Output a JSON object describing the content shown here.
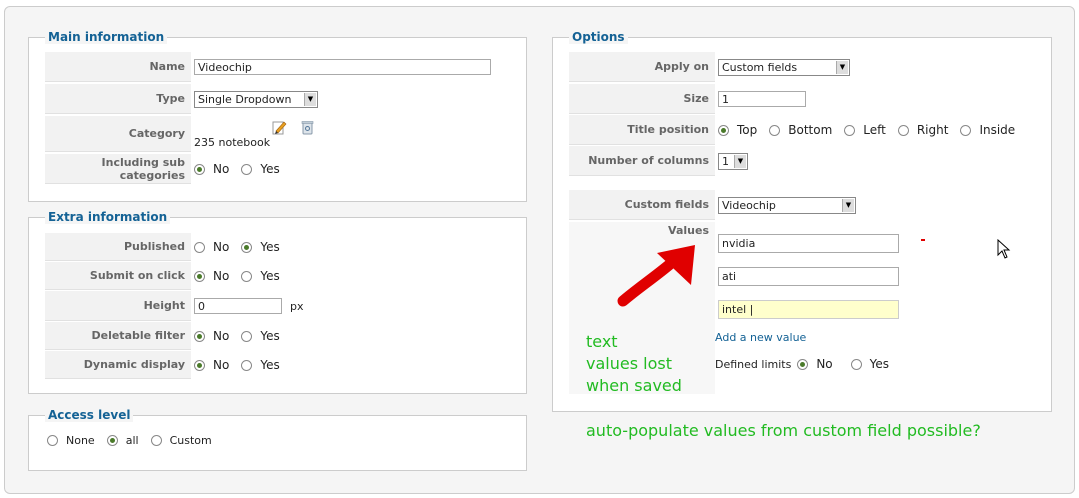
{
  "main": {
    "legend": "Main information",
    "name_label": "Name",
    "name_value": "Videochip",
    "type_label": "Type",
    "type_value": "Single Dropdown",
    "category_label": "Category",
    "category_value": "235 notebook",
    "sub_label": "Including sub categories",
    "sub_no": "No",
    "sub_yes": "Yes"
  },
  "extra": {
    "legend": "Extra information",
    "published_label": "Published",
    "submit_label": "Submit on click",
    "height_label": "Height",
    "height_value": "0",
    "height_unit": "px",
    "deletable_label": "Deletable filter",
    "dynamic_label": "Dynamic display",
    "no": "No",
    "yes": "Yes"
  },
  "access": {
    "legend": "Access level",
    "none": "None",
    "all": "all",
    "custom": "Custom"
  },
  "options": {
    "legend": "Options",
    "apply_label": "Apply on",
    "apply_value": "Custom fields",
    "size_label": "Size",
    "size_value": "1",
    "title_label": "Title position",
    "pos_top": "Top",
    "pos_bottom": "Bottom",
    "pos_left": "Left",
    "pos_right": "Right",
    "pos_inside": "Inside",
    "cols_label": "Number of columns",
    "cols_value": "1",
    "custom_label": "Custom fields",
    "custom_value": "Videochip",
    "values_label": "Values",
    "values": [
      "nvidia",
      "ati",
      "intel |"
    ],
    "add_value": "Add a new value",
    "limits_label": "Defined limits",
    "limits_no": "No",
    "limits_yes": "Yes"
  },
  "annotations": {
    "lost_1": "text",
    "lost_2": "values lost",
    "lost_3": "when saved",
    "populate": "auto-populate values from custom field possible?"
  }
}
